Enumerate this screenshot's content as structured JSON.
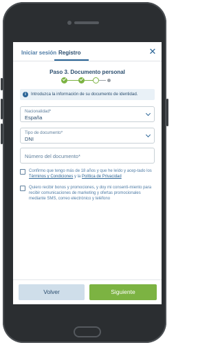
{
  "header": {
    "tab_login": "Iniciar sesión",
    "tab_register": "Registro",
    "close_icon": "close-icon"
  },
  "step": {
    "title": "Paso 3. Documento personal",
    "total_steps": 4,
    "current_step": 3
  },
  "info": {
    "icon": "info-icon",
    "text": "Introduzca la información de su documento de identidad."
  },
  "form": {
    "nationality": {
      "label": "Nacionalidad*",
      "value": "España"
    },
    "document_type": {
      "label": "Tipo de documento*",
      "value": "DNI"
    },
    "document_number": {
      "placeholder": "Número del documento*"
    }
  },
  "consents": {
    "terms": {
      "text_before": "Confirmo que tengo más de 18 años y que he leído y acep-tado los ",
      "terms_link": "Términos y Condiciones",
      "between": " y la ",
      "privacy_link": "Política de Privacidad"
    },
    "marketing": {
      "text": "Quiero recibir bonos y promociones, y doy mi consenti-miento para recibir comunicaciones de marketing y ofertas promocionales mediante SMS, correo electrónico y teléfono"
    }
  },
  "footer": {
    "back_label": "Volver",
    "next_label": "Siguiente"
  },
  "colors": {
    "primary": "#2a6496",
    "accent_green": "#7cb342",
    "back_button_bg": "#cfdeea"
  }
}
